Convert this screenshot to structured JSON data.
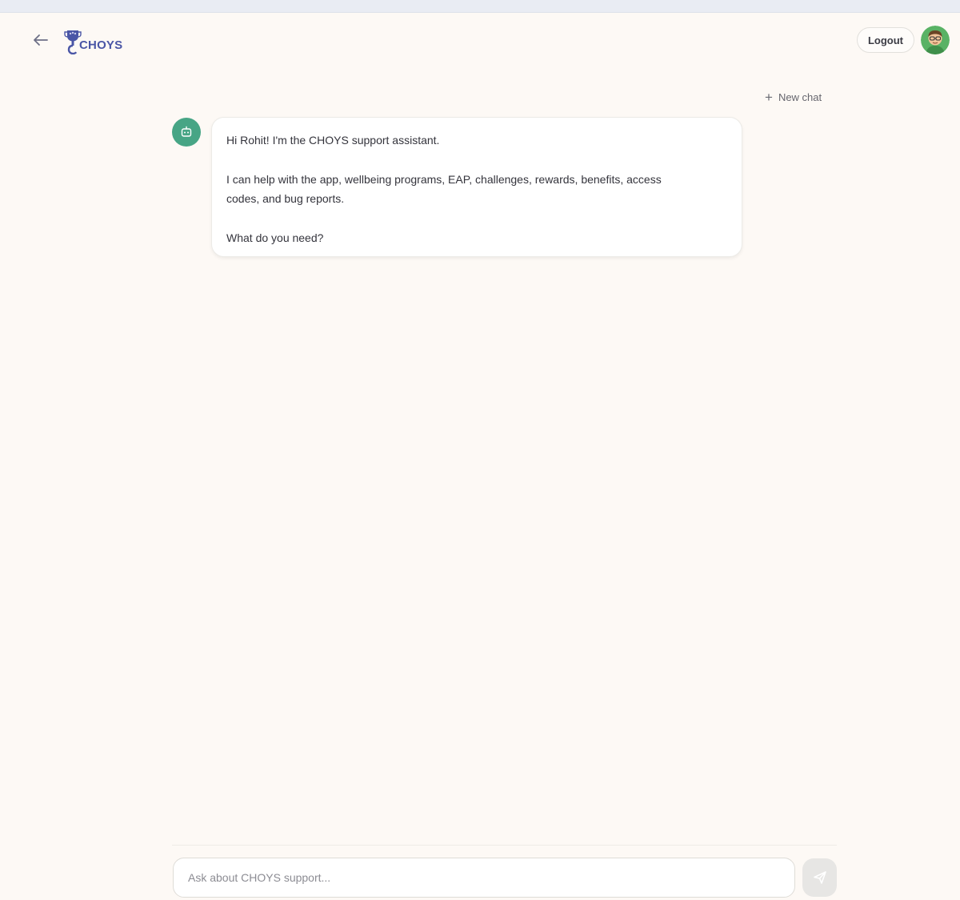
{
  "header": {
    "logo_text": "CHOYS",
    "logout_label": "Logout"
  },
  "toolbar": {
    "new_chat_label": "New chat"
  },
  "conversation": {
    "messages": [
      {
        "role": "assistant",
        "lines": [
          "Hi Rohit! I'm the CHOYS support assistant.",
          "",
          "I can help with the app, wellbeing programs, EAP, challenges, rewards, benefits, access",
          "codes, and bug reports.",
          "",
          "What do you need?"
        ]
      }
    ]
  },
  "composer": {
    "value": "",
    "placeholder": "Ask about CHOYS support..."
  },
  "icons": {
    "back": "arrow-left-icon",
    "logo": "trophy-icon",
    "new_chat": "plus-icon",
    "bot": "robot-icon",
    "send": "send-icon"
  },
  "colors": {
    "background": "#fdf9f5",
    "brand": "#4a56a6",
    "bot_accent": "#47a585",
    "send_disabled": "#e7e6e4"
  }
}
